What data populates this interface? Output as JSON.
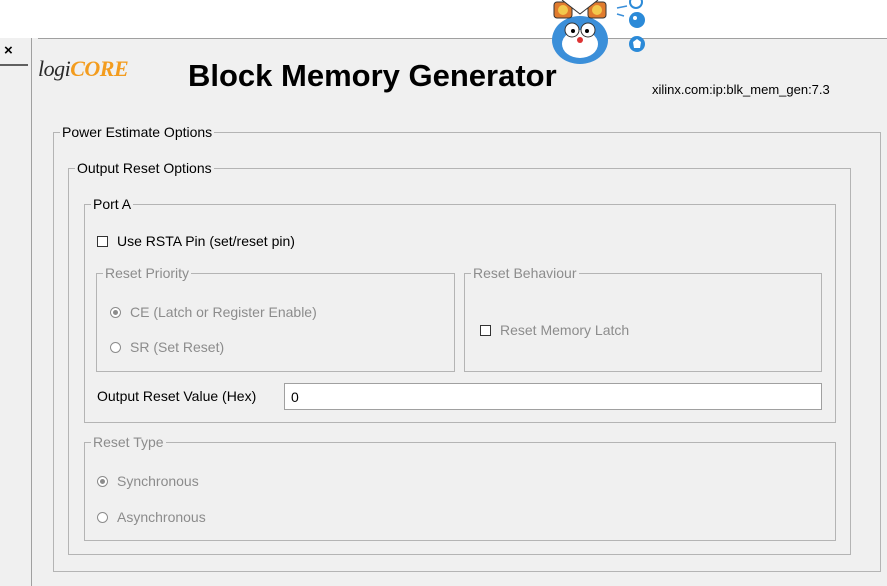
{
  "header": {
    "logo_prefix": "logi",
    "logo_core": "CORE",
    "title": "Block Memory Generator",
    "ip_id": "xilinx.com:ip:blk_mem_gen:7.3",
    "close_label": "×"
  },
  "power_estimate": {
    "legend": "Power Estimate Options"
  },
  "output_reset": {
    "legend": "Output Reset Options",
    "port_a": {
      "legend": "Port A",
      "use_rsta_label": "Use RSTA Pin (set/reset pin)",
      "use_rsta_checked": false,
      "reset_priority": {
        "legend": "Reset Priority",
        "options": [
          "CE (Latch or Register Enable)",
          "SR (Set Reset)"
        ],
        "selected": "CE (Latch or Register Enable)"
      },
      "reset_behaviour": {
        "legend": "Reset Behaviour",
        "reset_memory_latch_label": "Reset Memory Latch",
        "reset_memory_latch_checked": false
      },
      "output_reset_value_label": "Output Reset Value (Hex)",
      "output_reset_value": "0"
    },
    "reset_type": {
      "legend": "Reset Type",
      "options": [
        "Synchronous",
        "Asynchronous"
      ],
      "selected": "Synchronous"
    }
  }
}
